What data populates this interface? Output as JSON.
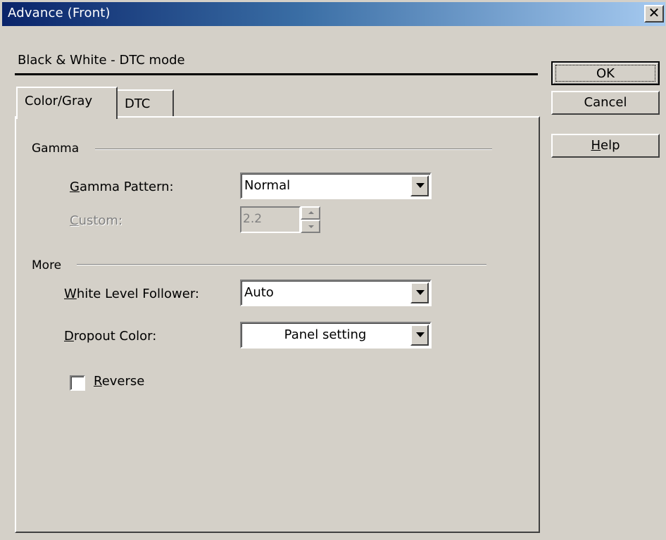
{
  "window": {
    "title": "Advance (Front)",
    "close_label": "✕"
  },
  "header": {
    "mode_label": "Black & White - DTC mode"
  },
  "buttons": {
    "ok": "OK",
    "cancel": "Cancel",
    "help": "Help"
  },
  "tabs": [
    {
      "label": "Color/Gray",
      "active": true
    },
    {
      "label": "DTC",
      "active": false
    }
  ],
  "gamma": {
    "group_label": "Gamma",
    "pattern_label": "Gamma Pattern:",
    "pattern_value": "Normal",
    "custom_label": "Custom:",
    "custom_value": "2.2",
    "custom_enabled": false
  },
  "more": {
    "group_label": "More",
    "white_level_label": "White Level Follower:",
    "white_level_value": "Auto",
    "dropout_label": "Dropout Color:",
    "dropout_value": "Panel setting",
    "reverse_label": "Reverse",
    "reverse_checked": false
  },
  "colors": {
    "face": "#d4d0c8",
    "title_start": "#0a246a",
    "title_end": "#a6caf0",
    "disabled_text": "#808080"
  }
}
